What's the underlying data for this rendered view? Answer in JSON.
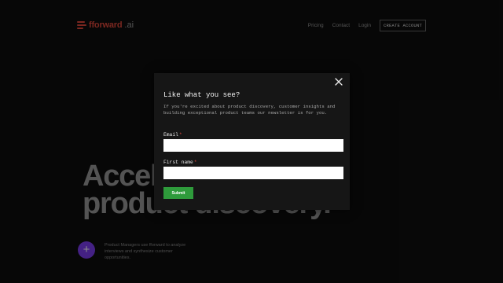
{
  "header": {
    "logo_text": "fforward",
    "logo_suffix": ".ai",
    "nav": [
      "Pricing",
      "Contact",
      "Login"
    ],
    "cta_label": "CREATE ACCOUNT"
  },
  "hero": {
    "line1": "Accel",
    "line2": "product discovery."
  },
  "feature": {
    "icon": "plus-icon",
    "text": "Product Managers use fforward to analyze interviews and synthesize customer opportunities."
  },
  "modal": {
    "title": "Like what you see?",
    "description": "If you're excited about product discovery, customer insights and building exceptional product teams our newsletter is for you.",
    "email_label": "Email",
    "email_value": "",
    "first_name_label": "First name",
    "first_name_value": "",
    "required_marker": "*",
    "submit_label": "Submit",
    "close_icon": "close-icon"
  },
  "colors": {
    "brand": "#e0483b",
    "accent": "#7d3cf0",
    "submit": "#2e9b3b"
  }
}
